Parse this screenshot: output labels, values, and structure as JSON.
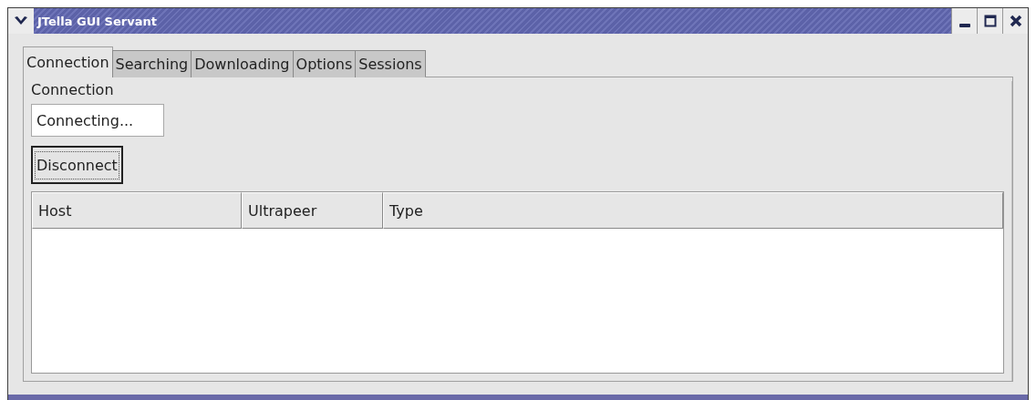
{
  "window": {
    "title": "JTella GUI Servant"
  },
  "tabs": [
    {
      "label": "Connection",
      "selected": true
    },
    {
      "label": "Searching",
      "selected": false
    },
    {
      "label": "Downloading",
      "selected": false
    },
    {
      "label": "Options",
      "selected": false
    },
    {
      "label": "Sessions",
      "selected": false
    }
  ],
  "group": {
    "title": "Connection"
  },
  "status_field": {
    "value": "Connecting..."
  },
  "disconnect_button": {
    "label": "Disconnect"
  },
  "table": {
    "columns": [
      "Host",
      "Ultrapeer",
      "Type"
    ]
  }
}
